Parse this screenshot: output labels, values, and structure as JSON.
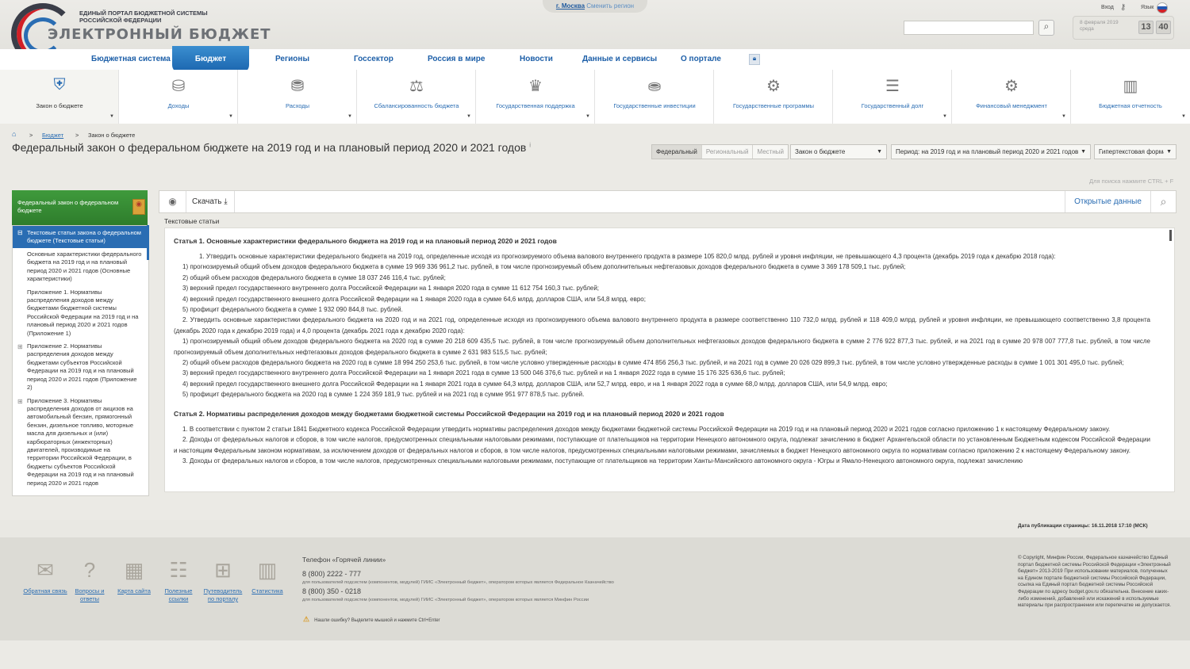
{
  "header": {
    "portal_name": "ЕДИНЫЙ ПОРТАЛ БЮДЖЕТНОЙ СИСТЕМЫ РОССИЙСКОЙ ФЕДЕРАЦИИ",
    "logo_text": "ЭЛЕКТРОННЫЙ БЮДЖЕТ",
    "city": "г. Москва",
    "change_region": "Сменить регион",
    "login": "Вход",
    "language": "Язык",
    "date": "8 февраля 2019 среда",
    "clock_hours": "13",
    "clock_minutes": "40",
    "search_placeholder": ""
  },
  "nav": {
    "items": [
      "Бюджетная система",
      "Бюджет",
      "Регионы",
      "Госсектор",
      "Россия в мире",
      "Новости",
      "Данные и сервисы",
      "О портале"
    ],
    "active": "Бюджет"
  },
  "subnav": {
    "items": [
      {
        "label": "Закон о бюджете",
        "icon": "emblem-icon"
      },
      {
        "label": "Доходы",
        "icon": "income-icon"
      },
      {
        "label": "Расходы",
        "icon": "expenses-icon"
      },
      {
        "label": "Сбалансированность бюджета",
        "icon": "scales-icon"
      },
      {
        "label": "Государственная поддержка",
        "icon": "eagle-icon"
      },
      {
        "label": "Государственные инвестиции",
        "icon": "investments-icon"
      },
      {
        "label": "Государственные программы",
        "icon": "programs-icon"
      },
      {
        "label": "Государственный долг",
        "icon": "debt-icon"
      },
      {
        "label": "Финансовый менеджмент",
        "icon": "management-icon"
      },
      {
        "label": "Бюджетная отчетность",
        "icon": "reporting-icon"
      }
    ]
  },
  "breadcrumb": {
    "level1": "Бюджет",
    "level2": "Закон о бюджете"
  },
  "page_title": "Федеральный закон о федеральном бюджете на 2019 год и на плановый период 2020 и 2021 годов",
  "filters": {
    "levels": [
      "Федеральный",
      "Региональный",
      "Местный"
    ],
    "active_level": "Федеральный",
    "section": "Закон о бюджете",
    "period": "Период: на 2019 год и на плановый период 2020 и 2021 годов",
    "format": "Гипертекстовая форма"
  },
  "search_hint": "Для поиска нажмите CTRL + F",
  "sidebar": {
    "title": "Федеральный закон о федеральном бюджете",
    "selected": "Текстовые статьи закона о федеральном бюджете (Текстовые статьи)",
    "items": [
      {
        "prefix": "",
        "text": "Основные характеристики федерального бюджета на 2019 год и на плановый период 2020 и 2021 годов (Основные характеристики)"
      },
      {
        "prefix": "",
        "text": "Приложение 1. Нормативы распределения доходов между бюджетами бюджетной системы Российской Федерации на 2019 год и на плановый период 2020 и 2021 годов (Приложение 1)"
      },
      {
        "prefix": "+",
        "text": "Приложение 2. Нормативы распределения доходов между бюджетами субъектов Российской Федерации на 2019 год и на плановый период 2020 и 2021 годов (Приложение 2)"
      },
      {
        "prefix": "+",
        "text": "Приложение 3. Нормативы распределения доходов от акцизов на автомобильный бензин, прямогонный бензин, дизельное топливо, моторные масла для дизельных и (или) карбюраторных (инжекторных) двигателей, производимые на территории Российской Федерации, в бюджеты субъектов Российской Федерации на 2019 год и на плановый период 2020 и 2021 годов"
      }
    ]
  },
  "toolbar": {
    "download": "Скачать",
    "open_data": "Открытые данные"
  },
  "content_tab": "Текстовые статьи",
  "articles": [
    {
      "title": "Статья 1. Основные характеристики федерального бюджета на 2019 год и на плановый период 2020 и 2021 годов",
      "paragraphs": [
        "1. Утвердить основные характеристики федерального бюджета на 2019 год, определенные исходя из прогнозируемого объема валового внутреннего продукта в размере 105 820,0 млрд. рублей и уровня инфляции, не превышающего 4,3 процента (декабрь 2019 года к декабрю 2018 года):",
        "1) прогнозируемый общий объем доходов федерального бюджета в сумме 19 969 336 961,2 тыс. рублей, в том числе прогнозируемый объем дополнительных нефтегазовых доходов федерального бюджета в сумме 3 369 178 509,1 тыс. рублей;",
        "2) общий объем расходов федерального бюджета в сумме 18 037 246 116,4 тыс. рублей;",
        "3) верхний предел государственного внутреннего долга Российской Федерации на 1 января 2020 года в сумме 11 612 754 160,3 тыс. рублей;",
        "4) верхний предел государственного внешнего долга Российской Федерации на 1 января 2020 года в сумме 64,6 млрд. долларов США, или 54,8 млрд. евро;",
        "5) профицит федерального бюджета в сумме 1 932 090 844,8 тыс. рублей.",
        "2. Утвердить основные характеристики федерального бюджета на 2020 год и на 2021 год, определенные исходя из прогнозируемого объема валового внутреннего продукта в размере соответственно 110 732,0 млрд. рублей и 118 409,0 млрд. рублей и уровня инфляции, не превышающего соответственно 3,8 процента (декабрь 2020 года к декабрю 2019 года) и 4,0 процента (декабрь 2021 года к декабрю 2020 года):",
        "1) прогнозируемый общий объем доходов федерального бюджета на 2020 год в сумме 20 218 609 435,5 тыс. рублей, в том числе прогнозируемый объем дополнительных нефтегазовых доходов федерального бюджета в сумме 2 776 922 877,3 тыс. рублей, и на 2021 год в сумме 20 978 007 777,8 тыс. рублей, в том числе прогнозируемый объем дополнительных нефтегазовых доходов федерального бюджета в сумме 2 631 983 515,5 тыс. рублей;",
        "2) общий объем расходов федерального бюджета на 2020 год в сумме 18 994 250 253,6 тыс. рублей, в том числе условно утвержденные расходы в сумме 474 856 256,3 тыс. рублей, и на 2021 год в сумме 20 026 029 899,3 тыс. рублей, в том числе условно утвержденные расходы в сумме 1 001 301 495,0 тыс. рублей;",
        "3) верхний предел государственного внутреннего долга Российской Федерации на 1 января 2021 года в сумме 13 500 046 376,6 тыс. рублей и на 1 января 2022 года в сумме 15 176 325 636,6 тыс. рублей;",
        "4) верхний предел государственного внешнего долга Российской Федерации на 1 января 2021 года в сумме 64,3 млрд. долларов США, или 52,7 млрд. евро, и на 1 января 2022 года в сумме 68,0 млрд. долларов США, или 54,9 млрд. евро;",
        "5) профицит федерального бюджета на 2020 год в сумме 1 224 359 181,9 тыс. рублей и на 2021 год в сумме 951 977 878,5 тыс. рублей."
      ]
    },
    {
      "title": "Статья 2. Нормативы распределения доходов между бюджетами бюджетной системы Российской Федерации на 2019 год и на плановый период 2020 и 2021 годов",
      "paragraphs": [
        "1. В соответствии с пунктом 2 статьи 1841 Бюджетного кодекса Российской Федерации утвердить нормативы распределения доходов между бюджетами бюджетной системы Российской Федерации на 2019 год и на плановый период 2020 и 2021 годов согласно приложению 1 к настоящему Федеральному закону.",
        "2. Доходы от федеральных налогов и сборов, в том числе налогов, предусмотренных специальными налоговыми режимами, поступающие от плательщиков на территории Ненецкого автономного округа, подлежат зачислению в бюджет Архангельской области по установленным Бюджетным кодексом Российской Федерации и настоящим Федеральным законом нормативам, за исключением доходов от федеральных налогов и сборов, в том числе налогов, предусмотренных специальными налоговыми режимами, зачисляемых в бюджет Ненецкого автономного округа по нормативам согласно приложению 2 к настоящему Федеральному закону.",
        "3. Доходы от федеральных налогов и сборов, в том числе налогов, предусмотренных специальными налоговыми режимами, поступающие от плательщиков на территории Ханты-Мансийского автономного округа - Югры и Ямало-Ненецкого автономного округа, подлежат зачислению"
      ]
    }
  ],
  "pub_date": "Дата публикации страницы: 16.11.2018 17:10 (МСК)",
  "footer": {
    "links": [
      {
        "label": "Обратная связь",
        "icon": "envelope-icon"
      },
      {
        "label": "Вопросы и ответы",
        "icon": "question-icon"
      },
      {
        "label": "Карта сайта",
        "icon": "map-icon"
      },
      {
        "label": "Полезные ссылки",
        "icon": "links-icon"
      },
      {
        "label": "Путеводитель по порталу",
        "icon": "guide-icon"
      },
      {
        "label": "Статистика",
        "icon": "statistics-icon"
      }
    ],
    "hotline_title": "Телефон «Горячей линии»",
    "phone1": "8 (800) 2222 - 777",
    "phone1_note": "для пользователей подсистем (компонентов, модулей) ГИИС «Электронный бюджет», оператором которых является Федеральное Казначейство",
    "phone2": "8 (800) 350 - 0218",
    "phone2_note": "для пользователей подсистем (компонентов, модулей) ГИИС «Электронный бюджет», оператором которых является Минфин России",
    "error_hint": "Нашли ошибку? Выделите мышкой и нажмите Ctrl+Enter",
    "copyright": "© Copyright, Минфин России, Федеральное казначейство Единый портал бюджетной системы Российской Федерации «Электронный бюджет» 2013-2019 При использовании материалов, полученных на Едином портале бюджетной системы Российской Федерации, ссылка на Единый портал бюджетной системы Российской Федерации по адресу budget.gov.ru обязательна. Внесение каких-либо изменений, добавлений или искажений в используемые материалы при распространении или перепечатке не допускается."
  }
}
